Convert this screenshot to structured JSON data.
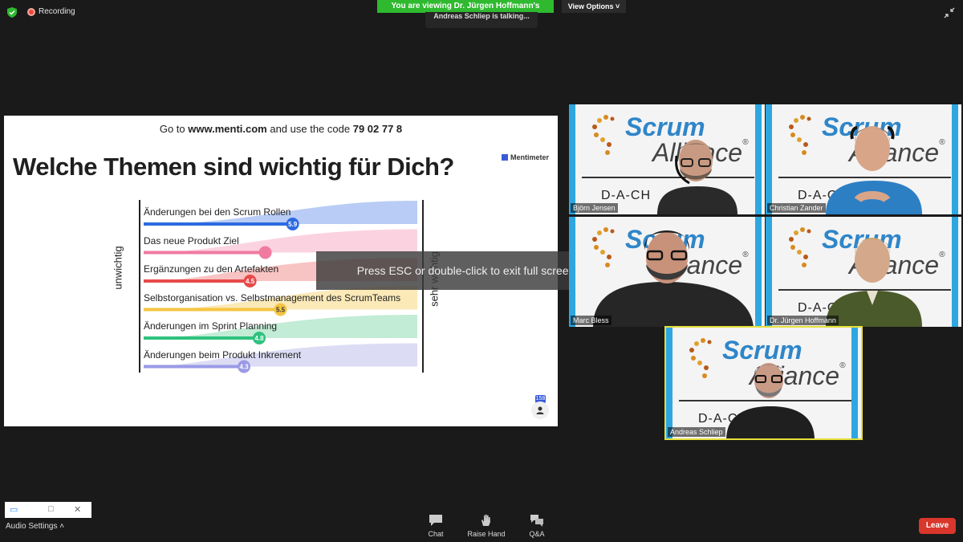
{
  "top_bar": {
    "recording_label": "Recording",
    "viewing_banner": "You are viewing Dr. Jürgen Hoffmann's screen",
    "view_options_label": "View Options ˅",
    "talking_indicator": "Andreas Schliep is talking..."
  },
  "slide": {
    "goto_prefix": "Go to ",
    "goto_url": "www.menti.com",
    "goto_middle": " and use the code ",
    "goto_code": "79 02 77 8",
    "title": "Welche Themen sind wichtig für Dich?",
    "brand": "Mentimeter",
    "axis_left": "unwichtig",
    "axis_right": "sehr wichtig",
    "response_count": "158"
  },
  "chart_data": {
    "type": "bar",
    "scale": [
      1,
      10
    ],
    "categories": [
      "Änderungen bei den Scrum Rollen",
      "Das neue Produkt Ziel",
      "Ergänzungen zu den Artefakten",
      "Selbstorganisation vs. Selbstmanagement des ScrumTeams",
      "Änderungen im Sprint Planning",
      "Änderungen beim Produkt Inkrement"
    ],
    "values": [
      5.9,
      5.0,
      4.5,
      5.5,
      4.8,
      4.3
    ],
    "value_labels": [
      "5.9",
      "",
      "4.5",
      "5.5",
      "4.8",
      "4.3"
    ],
    "colors": [
      "#2d6be0",
      "#f07aa0",
      "#e84a4a",
      "#f5c542",
      "#2ec27e",
      "#9a9ae6"
    ],
    "fills": [
      "#b9ccf5",
      "#fbd3e0",
      "#f8c3c3",
      "#fbe9b8",
      "#c2ecd5",
      "#dcdcf5"
    ]
  },
  "overlay": {
    "esc_message": "Press ESC or double-click to exit full screen mode"
  },
  "participants": [
    {
      "name": "Björn Jensen"
    },
    {
      "name": "Christian Zander"
    },
    {
      "name": "Marc Bless"
    },
    {
      "name": "Dr. Jürgen Hoffmann"
    },
    {
      "name": "Andreas Schliep"
    }
  ],
  "tile_logo": {
    "scrum": "Scrum",
    "alliance": "Alliance",
    "reg": "®",
    "dach": "D-A-CH"
  },
  "bottom_bar": {
    "audio_settings": "Audio Settings ˄",
    "chat": "Chat",
    "raise_hand": "Raise Hand",
    "qa": "Q&A",
    "leave": "Leave"
  },
  "colors": {
    "banner_green": "#2fb92f",
    "leave_red": "#d9362c",
    "active_speaker": "#e6df3c"
  }
}
